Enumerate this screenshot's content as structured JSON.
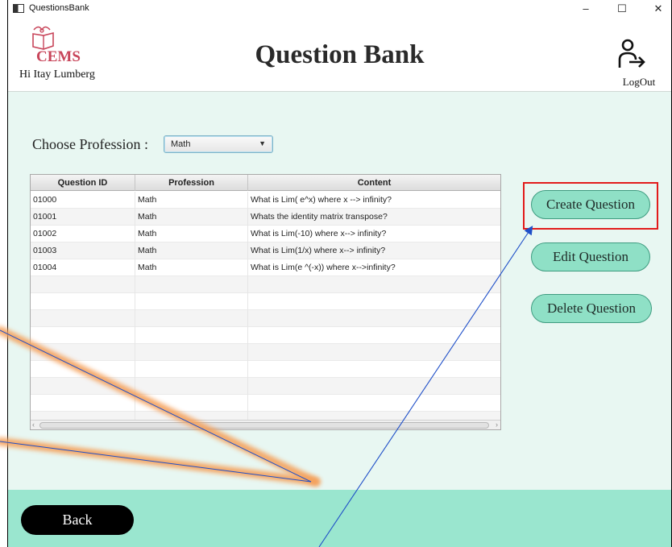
{
  "window": {
    "title": "QuestionsBank",
    "controls": {
      "minimize": "–",
      "maximize": "☐",
      "close": "✕"
    }
  },
  "header": {
    "logo_text": "CEMS",
    "greeting": "Hi Itay Lumberg",
    "title": "Question Bank",
    "logout_label": "LogOut",
    "logo_color": "#c8455a"
  },
  "filter": {
    "label": "Choose Profession :",
    "selected": "Math"
  },
  "table": {
    "columns": [
      "Question ID",
      "Profession",
      "Content"
    ],
    "rows": [
      [
        "01000",
        "Math",
        "What is Lim( e^x) where x --> infinity?"
      ],
      [
        "01001",
        "Math",
        "Whats the identity matrix transpose?"
      ],
      [
        "01002",
        "Math",
        "What is Lim(-10) where x--> infinity?"
      ],
      [
        "01003",
        "Math",
        "What is Lim(1/x) where x--> infinity?"
      ],
      [
        "01004",
        "Math",
        "What is Lim(e ^(-x)) where x-->infinity?"
      ],
      [
        "",
        "",
        ""
      ],
      [
        "",
        "",
        ""
      ],
      [
        "",
        "",
        ""
      ],
      [
        "",
        "",
        ""
      ],
      [
        "",
        "",
        ""
      ],
      [
        "",
        "",
        ""
      ],
      [
        "",
        "",
        ""
      ],
      [
        "",
        "",
        ""
      ],
      [
        "",
        "",
        ""
      ]
    ]
  },
  "actions": {
    "create": "Create Question",
    "edit": "Edit Question",
    "delete": "Delete Question"
  },
  "footer": {
    "back": "Back"
  },
  "colors": {
    "content_bg": "#e8f7f2",
    "footer_bg": "#9ae6cf",
    "button_bg": "#8fe0c6",
    "highlight": "#e21b1b",
    "annotation_arrow": "#1f4fc8",
    "annotation_glow": "#f5a05a"
  }
}
